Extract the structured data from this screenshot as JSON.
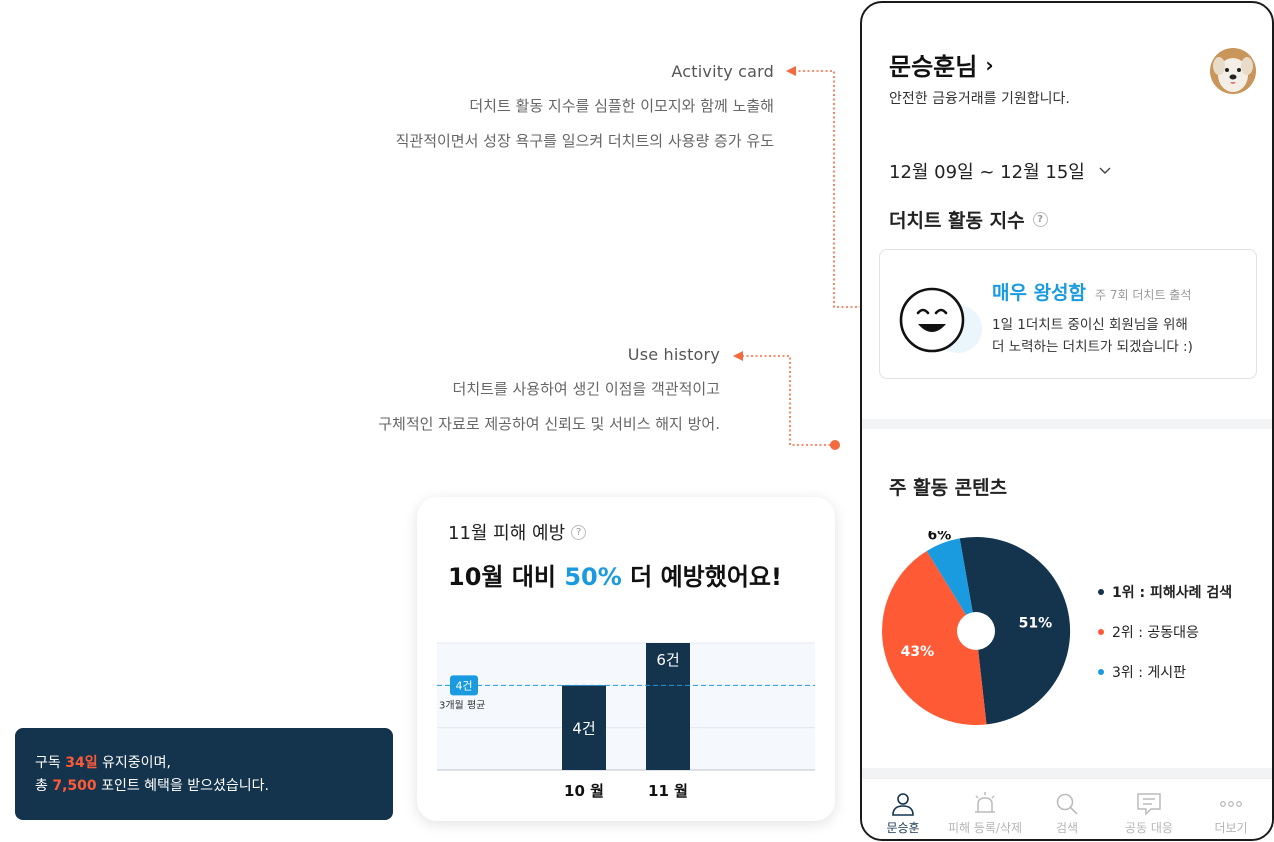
{
  "annotations": {
    "activity_card": {
      "title": "Activity card",
      "lines": [
        "더치트 활동 지수를 심플한 이모지와 함께 노출해",
        "직관적이면서 성장 욕구를 일으켜 더치트의 사용량 증가 유도"
      ]
    },
    "use_history": {
      "title": "Use history",
      "lines": [
        "더치트를 사용하여 생긴 이점을 객관적이고",
        "구체적인 자료로 제공하여 신뢰도 및 서비스 해지 방어."
      ]
    },
    "connector_color": "#f26a3d"
  },
  "subscription": {
    "line1_pre": "구독 ",
    "days": "34일",
    "line1_post": " 유지중이며,",
    "line2_pre": "총 ",
    "points": "7,500",
    "line2_post": " 포인트 혜택을 받으셨습니다."
  },
  "prevention": {
    "title": "11월 피해 예방",
    "help_glyph": "?",
    "headline_pre": "10월 대비 ",
    "headline_pct": "50%",
    "headline_post": " 더 예방했어요!",
    "avg_badge": "4건",
    "avg_label": "3개월 평균"
  },
  "phone": {
    "user_name": "문승훈님",
    "greeting": "안전한 금융거래를 기원합니다.",
    "date_range": "12월 09일 ~ 12월 15일",
    "activity_label": "더치트 활동 지수",
    "activity_level": "매우 왕성함",
    "activity_count": "주 7회 더치트 출석",
    "activity_msg": [
      "1일 1더치트 중이신 회원님을 위해",
      "더 노력하는 더치트가 되겠습니다 :)"
    ],
    "contents_label": "주 활동 콘텐츠",
    "legend": [
      {
        "label": "1위 : 피해사례 검색",
        "color": "#14344d"
      },
      {
        "label": "2위 : 공동대응",
        "color": "#ff5a36"
      },
      {
        "label": "3위 : 게시판",
        "color": "#1a9be0"
      }
    ],
    "tabs": [
      {
        "label": "문승훈",
        "icon": "person-icon",
        "active": true
      },
      {
        "label": "피해 등록/삭제",
        "icon": "siren-icon",
        "active": false
      },
      {
        "label": "검색",
        "icon": "search-icon",
        "active": false
      },
      {
        "label": "공동 대응",
        "icon": "chat-icon",
        "active": false
      },
      {
        "label": "더보기",
        "icon": "more-icon",
        "active": false
      }
    ]
  },
  "chart_data": [
    {
      "type": "bar",
      "title": "11월 피해 예방",
      "categories": [
        "10 월",
        "11 월"
      ],
      "values": [
        4,
        6
      ],
      "value_labels": [
        "4건",
        "6건"
      ],
      "reference_line": {
        "value": 4,
        "label": "3개월 평균",
        "badge": "4건"
      },
      "ylim": [
        0,
        6
      ],
      "color": "#14344d"
    },
    {
      "type": "pie",
      "categories": [
        "피해사례 검색",
        "공동대응",
        "게시판"
      ],
      "values": [
        51,
        43,
        6
      ],
      "labels": [
        "51%",
        "43%",
        "6%"
      ],
      "colors": [
        "#14344d",
        "#ff5a36",
        "#1a9be0"
      ]
    }
  ]
}
